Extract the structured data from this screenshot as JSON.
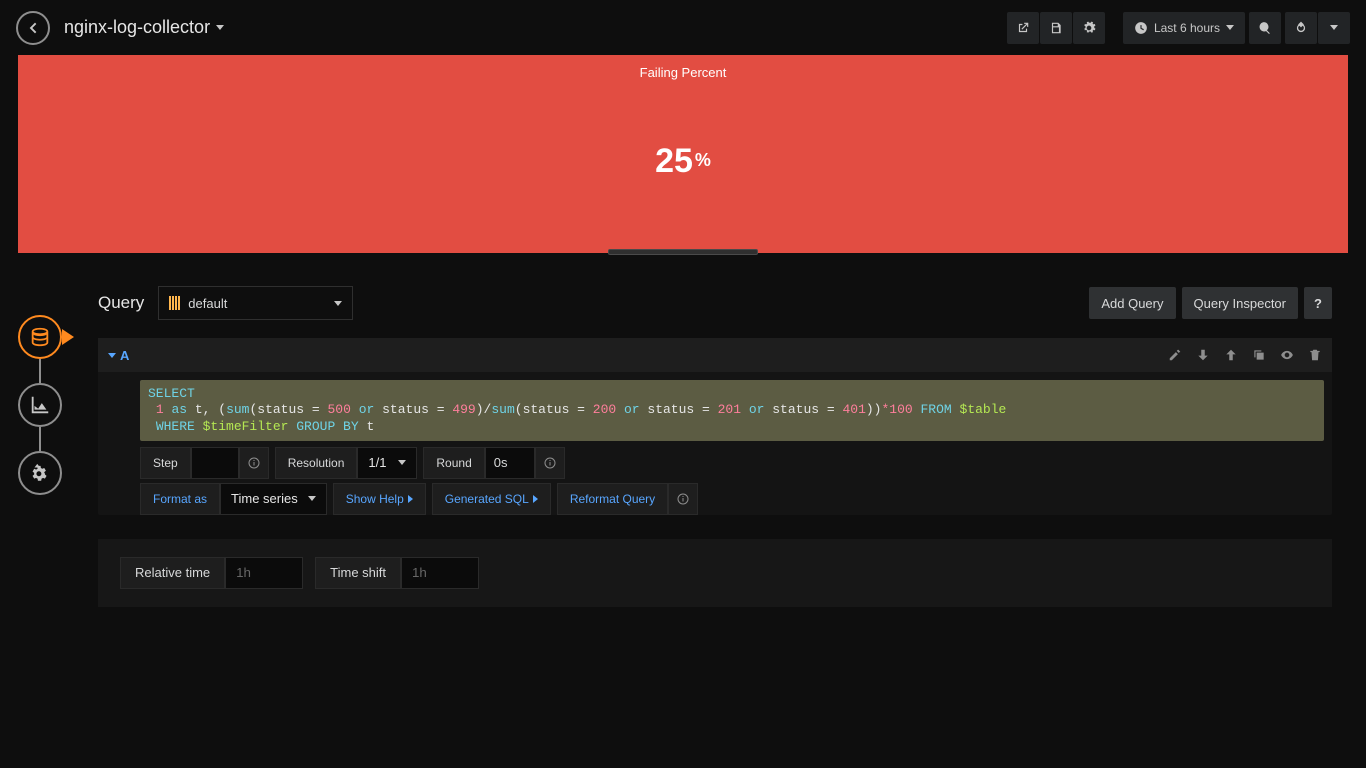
{
  "navbar": {
    "dashboard_title": "nginx-log-collector",
    "time_label": "Last 6 hours"
  },
  "panel": {
    "title": "Failing Percent",
    "value": "25",
    "suffix": "%"
  },
  "editor": {
    "section_title": "Query",
    "datasource": "default",
    "buttons": {
      "add_query": "Add Query",
      "inspector": "Query Inspector",
      "help": "?"
    },
    "query_ref": "A",
    "sql": {
      "select": "SELECT",
      "one": "1",
      "as": "as",
      "t": " t, (",
      "sum1": "sum",
      "status_eq1": "(status = ",
      "v500": "500",
      "or": " or ",
      "status_eq2": "status = ",
      "v499": "499",
      "close_div": ")",
      "slash": "/",
      "sum2": "sum",
      "open2": "(status = ",
      "v200": "200",
      "v201": "201",
      "v401": "401",
      "close_all": "))",
      "star": "*",
      "hundred": "100",
      "from": " FROM ",
      "table": "$table",
      "where": "WHERE ",
      "timefilter": "$timeFilter",
      "group_by": " GROUP BY ",
      "t2": "t"
    },
    "step_label": "Step",
    "resolution_label": "Resolution",
    "resolution_value": "1/1",
    "round_label": "Round",
    "round_value": "0s",
    "format_as_label": "Format as",
    "format_as_value": "Time series",
    "show_help": "Show Help",
    "generated_sql": "Generated SQL",
    "reformat_query": "Reformat Query"
  },
  "time_panel": {
    "relative_label": "Relative time",
    "relative_placeholder": "1h",
    "shift_label": "Time shift",
    "shift_placeholder": "1h"
  }
}
